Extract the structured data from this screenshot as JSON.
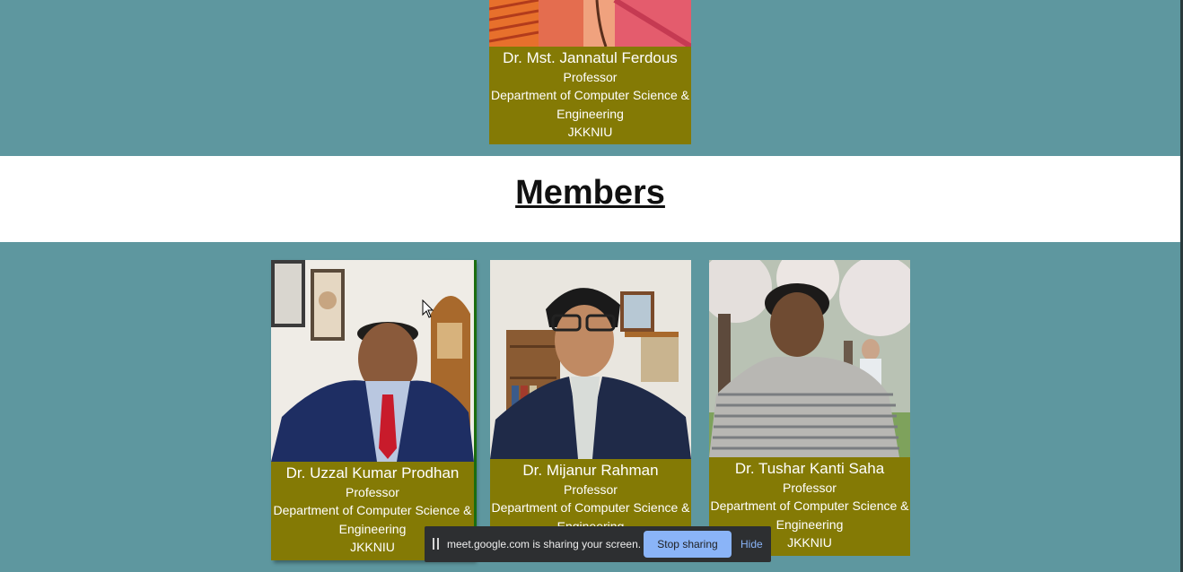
{
  "top_member": {
    "name": "Dr. Mst. Jannatul Ferdous",
    "title": "Professor",
    "department_line1": "Department of Computer Science &",
    "department_line2": "Engineering",
    "institution": "JKKNIU"
  },
  "members_section": {
    "heading": "Members"
  },
  "members": [
    {
      "name": "Dr. Uzzal Kumar Prodhan",
      "title": "Professor",
      "department_line1": "Department of Computer Science &",
      "department_line2": "Engineering",
      "institution": "JKKNIU"
    },
    {
      "name": "Dr. Mijanur Rahman",
      "title": "Professor",
      "department_line1": "Department of Computer Science &",
      "department_line2": "Engineering"
    },
    {
      "name": "Dr. Tushar Kanti Saha",
      "title": "Professor",
      "department_line1": "Department of Computer Science &",
      "department_line2": "Engineering",
      "institution": "JKKNIU"
    }
  ],
  "screen_share_bar": {
    "message": "meet.google.com is sharing your screen.",
    "stop_label": "Stop sharing",
    "hide_label": "Hide",
    "icon": "pause-icon"
  },
  "colors": {
    "page_background": "#5e979f",
    "card_background": "#847a05",
    "members_band": "#ffffff",
    "share_bar": "#2d2f31",
    "stop_button": "#8ab4f8"
  }
}
